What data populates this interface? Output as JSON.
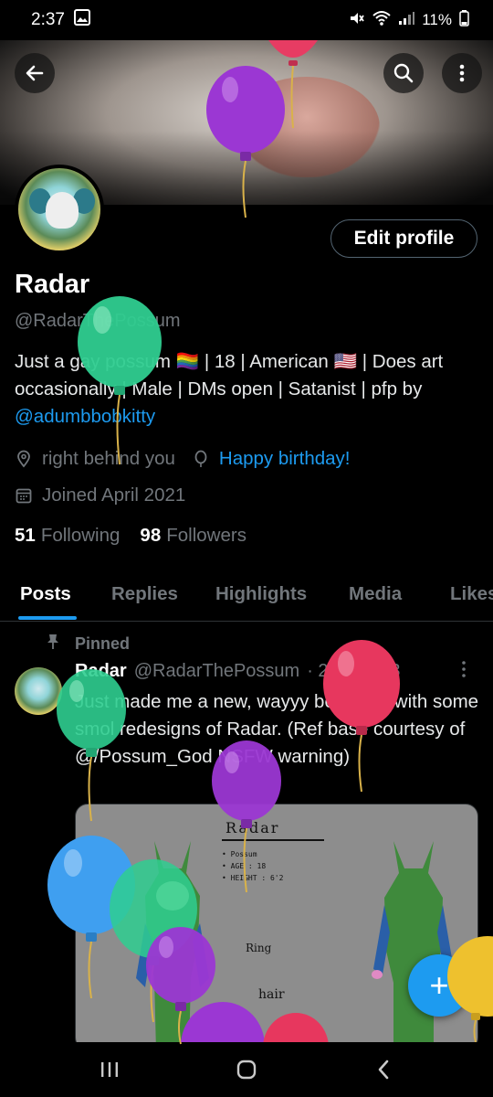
{
  "status": {
    "time": "2:37",
    "battery": "11%"
  },
  "profile": {
    "name": "Radar",
    "handle": "@RadarThePossum",
    "edit_label": "Edit profile",
    "bio_text": "Just a gay possum 🏳️‍🌈 | 18 | American 🇺🇸 | Does art occasionally | Male | DMs open | Satanist | pfp by ",
    "bio_link": "@adumbbobkitty",
    "location": "right behind you",
    "birthday": "Happy birthday!",
    "joined": "Joined April 2021",
    "following_count": "51",
    "following_label": "Following",
    "followers_count": "98",
    "followers_label": "Followers"
  },
  "tabs": [
    "Posts",
    "Replies",
    "Highlights",
    "Media",
    "Likes"
  ],
  "post": {
    "pinned_label": "Pinned",
    "author": "Radar",
    "handle": "@RadarThePossum",
    "date": "· 23 Feb 23",
    "text": "Just made me a new, wayyy better ref with some smol redesigns of Radar. (Ref base courtesy of @/Possum_God NSFW warning)",
    "image": {
      "title": "Radar",
      "line1": "• Possum",
      "line2": "• AGE : 18",
      "line3": "• HEIGHT : 6'2",
      "ring": "Ring",
      "hair": "hair"
    }
  },
  "fab_symbol": "+",
  "colors": {
    "accent": "#1d9bf0",
    "background": "#000000",
    "muted": "#71767b"
  }
}
